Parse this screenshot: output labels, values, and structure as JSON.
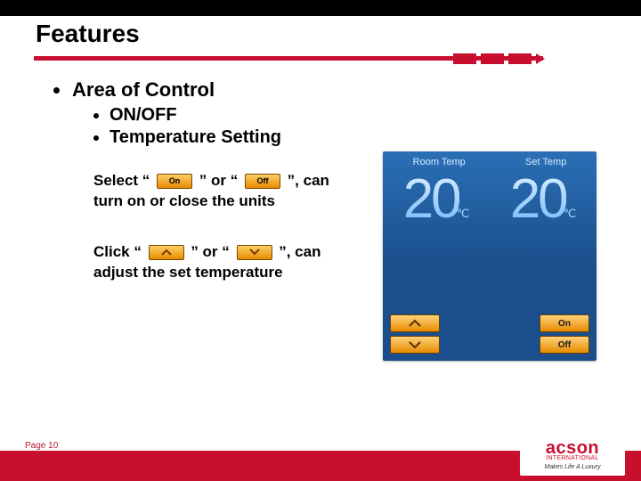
{
  "title": "Features",
  "heading": "Area of Control",
  "sub1": "ON/OFF",
  "sub2": "Temperature Setting",
  "para1": {
    "t1": "Select “ ",
    "on": "On",
    "t2": " ” or “ ",
    "off": "Off",
    "t3": " ”, can turn on or close the units"
  },
  "para2": {
    "t1": "Click “ ",
    "t2": " ” or “ ",
    "t3": " ”, can adjust the set temperature"
  },
  "device": {
    "head_room": "Room Temp",
    "head_set": "Set Temp",
    "room_val": "20",
    "set_val": "20",
    "unit": "℃",
    "on": "On",
    "off": "Off"
  },
  "page": "Page 10",
  "logo": {
    "name": "acson",
    "sub": "INTERNATIONAL",
    "tag": "Makes Life A Luxury"
  }
}
